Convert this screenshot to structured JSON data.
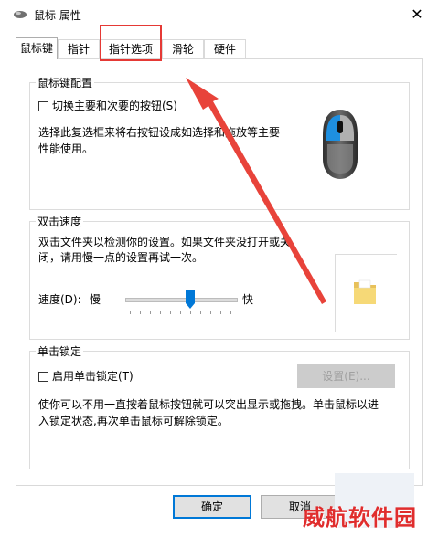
{
  "window": {
    "title": "鼠标 属性",
    "close_glyph": "✕"
  },
  "tabs": [
    {
      "label": "鼠标键",
      "active": true
    },
    {
      "label": "指针",
      "active": false
    },
    {
      "label": "指针选项",
      "active": false
    },
    {
      "label": "滑轮",
      "active": false
    },
    {
      "label": "硬件",
      "active": false
    }
  ],
  "button_config": {
    "group_title": "鼠标键配置",
    "switch_checkbox_label": "切换主要和次要的按钮(S)",
    "switch_checked": false,
    "description_line1": "选择此复选框来将右按钮设成如选择和拖放等主要",
    "description_line2": "性能使用。"
  },
  "double_click": {
    "group_title": "双击速度",
    "description_line1": "双击文件夹以检测你的设置。如果文件夹没打开或关",
    "description_line2": "闭，请用慢一点的设置再试一次。",
    "speed_label": "速度(D):",
    "slow_label": "慢",
    "fast_label": "快",
    "speed_level_percent": 58
  },
  "click_lock": {
    "group_title": "单击锁定",
    "enable_checkbox_label": "启用单击锁定(T)",
    "enable_checked": false,
    "settings_button": "设置(E)...",
    "description_line1": "使你可以不用一直按着鼠标按钮就可以突出显示或拖拽。单击鼠标以进",
    "description_line2": "入锁定状态,再次单击鼠标可解除锁定。"
  },
  "footer": {
    "ok_button": "确定",
    "cancel_button": "取消"
  },
  "annotation": {
    "highlight_color": "#e53935",
    "arrow_color": "#e8433a"
  },
  "watermark": {
    "text": "威航软件园"
  },
  "icons": {
    "title": "mouse-icon",
    "illustration": "mouse-illustration-icon",
    "folder": "folder-icon",
    "slider": "slider-thumb-icon"
  }
}
